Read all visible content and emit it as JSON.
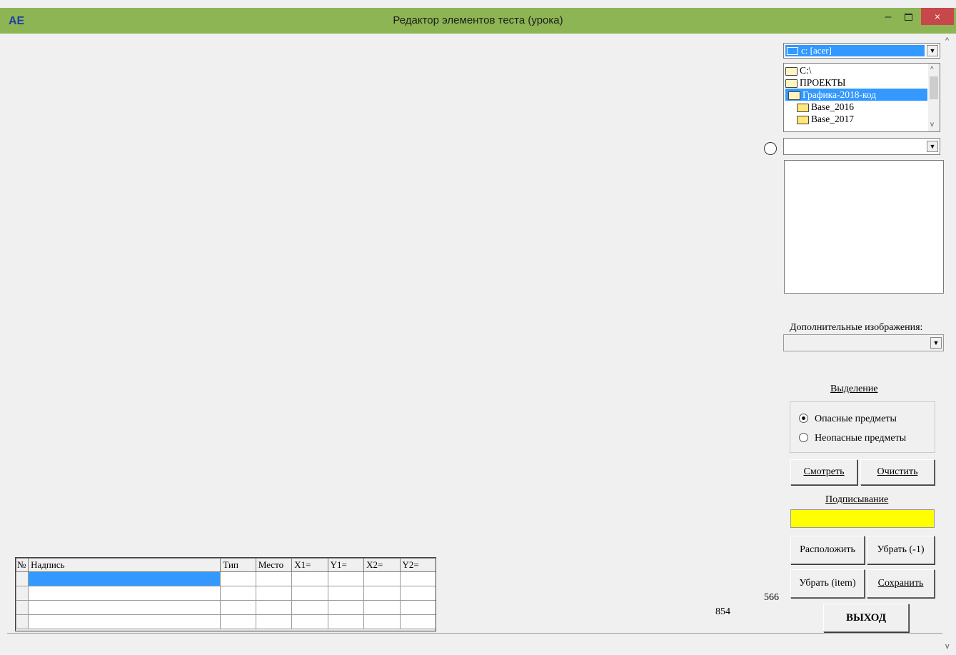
{
  "window": {
    "title": "Редактор элементов теста (урока)",
    "app_icon": "AE",
    "minimize_glyph": "–",
    "close_glyph": "×"
  },
  "drive_combo": {
    "value": "c: [acer]"
  },
  "folders": [
    {
      "label": "C:\\",
      "state": "open"
    },
    {
      "label": "ПРОЕКТЫ",
      "state": "open"
    },
    {
      "label": "Графика-2018-код",
      "state": "open-selected"
    },
    {
      "label": "Base_2016",
      "state": "closed"
    },
    {
      "label": "Base_2017",
      "state": "closed"
    }
  ],
  "additional_images": {
    "label": "Дополнительные изображения:"
  },
  "selection": {
    "title": "Выделение",
    "options": [
      "Опасные предметы",
      "Неопасные предметы"
    ],
    "selected_index": 0
  },
  "buttons": {
    "view": "Смотреть",
    "clear": "Очистить",
    "arrange": "Расположить",
    "remove_last": "Убрать (-1)",
    "remove_item": "Убрать (item)",
    "save": "Сохранить",
    "exit": "ВЫХОД"
  },
  "labeling": {
    "title": "Подписывание"
  },
  "readouts": {
    "a": "566",
    "b": "854"
  },
  "table": {
    "columns": [
      "№",
      "Надпись",
      "Тип",
      "Место",
      "X1=",
      "Y1=",
      "X2=",
      "Y2="
    ],
    "rows": [
      [
        "",
        "",
        "",
        "",
        "",
        "",
        "",
        ""
      ],
      [
        "",
        "",
        "",
        "",
        "",
        "",
        "",
        ""
      ],
      [
        "",
        "",
        "",
        "",
        "",
        "",
        "",
        ""
      ],
      [
        "",
        "",
        "",
        "",
        "",
        "",
        "",
        ""
      ]
    ]
  },
  "colors": {
    "titlebar": "#8db553",
    "selection": "#3399ff",
    "label_field": "#ffff00",
    "close_button": "#c7474a"
  }
}
